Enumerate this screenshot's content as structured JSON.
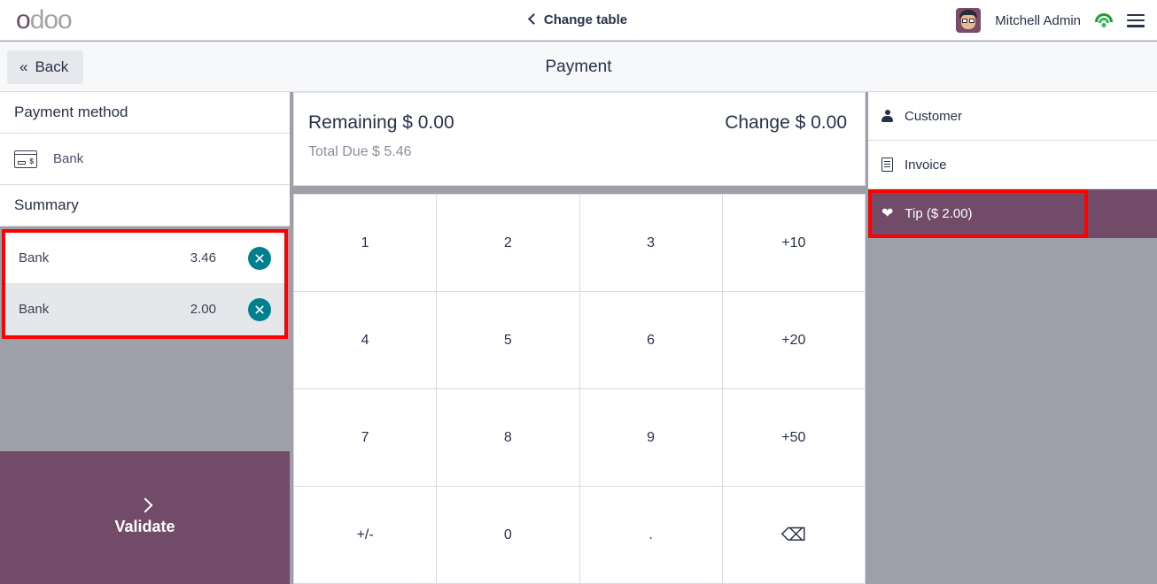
{
  "topbar": {
    "logo_first": "o",
    "logo_rest": "doo",
    "change_table": "Change table",
    "username": "Mitchell Admin",
    "wifi_icon": "wifi-icon",
    "menu_icon": "hamburger-menu-icon"
  },
  "subheader": {
    "back_label": "Back",
    "back_chevron": "«",
    "title": "Payment"
  },
  "left": {
    "payment_method_title": "Payment method",
    "method": {
      "label": "Bank",
      "icon": "credit-card-icon"
    },
    "summary_title": "Summary",
    "lines": [
      {
        "name": "Bank",
        "amount": "3.46",
        "selected": false
      },
      {
        "name": "Bank",
        "amount": "2.00",
        "selected": true
      }
    ],
    "validate_label": "Validate"
  },
  "center": {
    "remaining_label": "Remaining",
    "remaining_value": "$ 0.00",
    "change_label": "Change",
    "change_value": "$ 0.00",
    "total_due_label": "Total Due",
    "total_due_value": "$ 5.46",
    "numpad": [
      "1",
      "2",
      "3",
      "+10",
      "4",
      "5",
      "6",
      "+20",
      "7",
      "8",
      "9",
      "+50",
      "+/-",
      "0",
      ".",
      "⌫"
    ]
  },
  "right": {
    "customer_label": "Customer",
    "invoice_label": "Invoice",
    "tip_label": "Tip ($ 2.00)"
  },
  "colors": {
    "brand_purple": "#714B67",
    "teal_delete": "#00808c",
    "highlight_red": "#ff0000",
    "panel_gray": "#9da0a8"
  }
}
